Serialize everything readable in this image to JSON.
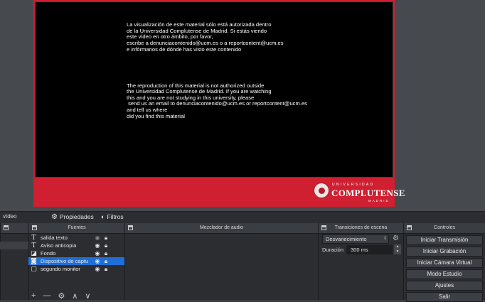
{
  "preview": {
    "notice_es": "La visualización de este material sólo está autorizada dentro\nde la Universidad Complutense de Madrid. Si estás viendo\neste vídeo en otro ámbito, por favor,\nescribe a denunciacontenido@ucm.es o a reportcontent@ucm.es\ne infórmanos de dónde has visto este contenido",
    "notice_en": "The reproduction of this material is not authorized outside\nthe Universidad Complutense de Madrid. If you are watching\nthis and you are not studying in this university, please\n send us an email to denunciacontenido@ucm.es or reportcontent@ucm.es\nand tell us where\ndid you find this material",
    "logo": {
      "line1": "UNIVERSIDAD",
      "line2": "COMPLUTENSE",
      "line3": "MADRID"
    },
    "colors": {
      "banner": "#cf1f31",
      "video_bg": "#000000"
    }
  },
  "toolbar": {
    "left_partial": "vídeo",
    "properties": "Propiedades",
    "filters": "Filtros"
  },
  "sources": {
    "title": "Fuentes",
    "items": [
      {
        "label": "salida texto",
        "icon": "text-icon",
        "glyph": "T",
        "visible": false,
        "selected": false
      },
      {
        "label": "Aviso anticopia",
        "icon": "text-icon",
        "glyph": "T",
        "visible": true,
        "selected": false
      },
      {
        "label": "Fondo",
        "icon": "image-icon",
        "glyph": "◪",
        "visible": true,
        "selected": false
      },
      {
        "label": "Dispositivo de captu",
        "icon": "camera-icon",
        "glyph": "◙",
        "visible": true,
        "selected": true
      },
      {
        "label": "segundo monitor",
        "icon": "display-icon",
        "glyph": "▢",
        "visible": true,
        "selected": false
      }
    ],
    "toolbar": {
      "add": "+",
      "remove": "—",
      "settings": "⚙",
      "up": "∧",
      "down": "∨"
    }
  },
  "mixer": {
    "title": "Mezclador de audio"
  },
  "transitions": {
    "title": "Transiciones de escena",
    "selected": "Desvanecimiento",
    "duration_label": "Duración",
    "duration_value": "300 ms"
  },
  "controls": {
    "title": "Controles",
    "buttons": [
      "Iniciar Transmisión",
      "Iniciar Grabación",
      "Iniciar Cámara Virtual",
      "Modo Estudio",
      "Ajustes",
      "Salir"
    ]
  }
}
